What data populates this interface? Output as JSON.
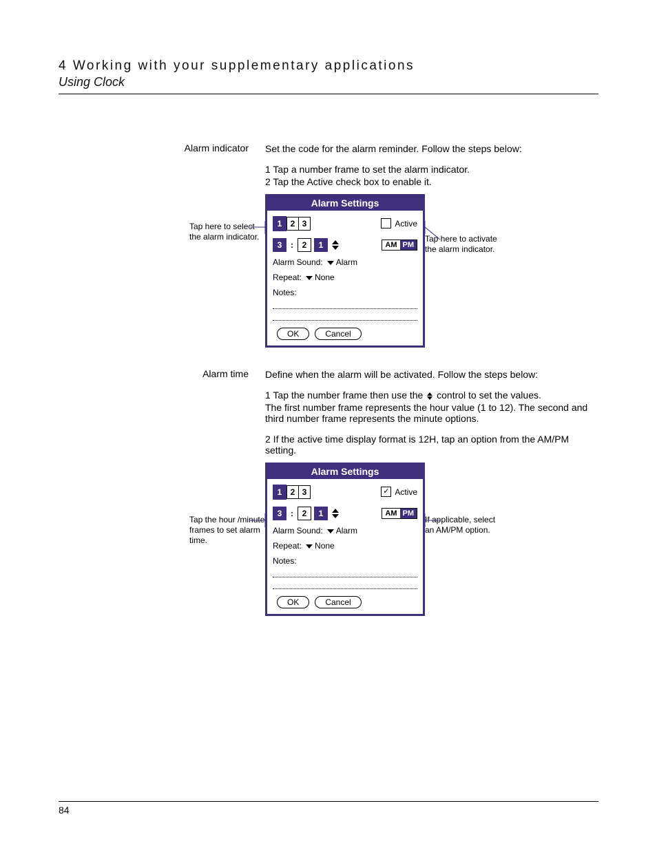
{
  "header": {
    "chapter": "4 Working with your supplementary applications",
    "section": "Using Clock"
  },
  "alarm_indicator": {
    "term": "Alarm indicator",
    "descr": "Set the code for the alarm reminder. Follow the steps below:",
    "step1": "1 Tap a number frame to set the alarm indicator.",
    "step2": "2 Tap the Active check box to enable it.",
    "callout_left": "Tap here to select the alarm indicator.",
    "callout_right": "Tap here to activate the alarm indicator."
  },
  "device1": {
    "title": "Alarm Settings",
    "ind": [
      "1",
      "2",
      "3"
    ],
    "active_label": "Active",
    "active_checked": false,
    "hour": "3",
    "min1": "2",
    "min2": "1",
    "am": "AM",
    "pm": "PM",
    "pm_selected": true,
    "sound_label": "Alarm Sound:",
    "sound_value": "Alarm",
    "repeat_label": "Repeat:",
    "repeat_value": "None",
    "notes_label": "Notes:",
    "ok": "OK",
    "cancel": "Cancel"
  },
  "alarm_time": {
    "term": "Alarm time",
    "descr": "Define when the alarm will be activated. Follow the steps below:",
    "step1a": "1 Tap the number frame then use the ",
    "step1b": " control to set the values.",
    "step1c": "The first number frame represents the hour value (1 to 12). The second and third number frame represents the minute options.",
    "step2": "2 If the active time display format is 12H, tap an option from the AM/PM setting.",
    "callout_left": "Tap the hour /minute frames to set alarm time.",
    "callout_right": "If applicable, select an AM/PM option."
  },
  "device2": {
    "title": "Alarm Settings",
    "ind": [
      "1",
      "2",
      "3"
    ],
    "active_label": "Active",
    "active_checked": true,
    "hour": "3",
    "min1": "2",
    "min2": "1",
    "am": "AM",
    "pm": "PM",
    "pm_selected": true,
    "sound_label": "Alarm Sound:",
    "sound_value": "Alarm",
    "repeat_label": "Repeat:",
    "repeat_value": "None",
    "notes_label": "Notes:",
    "ok": "OK",
    "cancel": "Cancel"
  },
  "page_number": "84"
}
